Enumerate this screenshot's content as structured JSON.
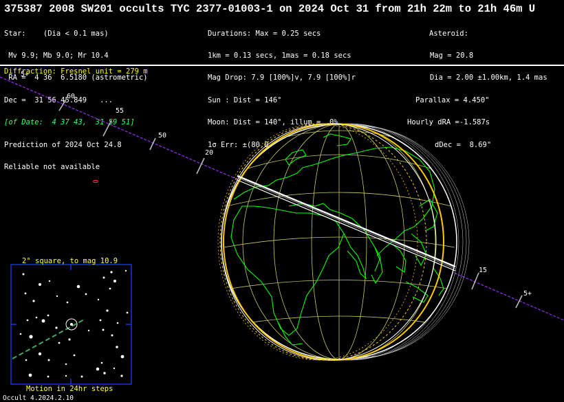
{
  "title": "375387 2008 SW201 occults TYC 2377-01003-1 on 2024 Oct 31 from 21h 22m to 21h 46m U",
  "star_block": [
    "Star:    (Dia < 0.1 mas)",
    " Mv 9.9; Mb 9.0; Mr 10.4",
    " RA =  4 36  6.5180 (astrometric)",
    "Dec =  31 56 45.849   ...",
    "[of Date:  4 37 43,  31 59 51]",
    "Prediction of 2024 Oct 24.8",
    "Reliable not available"
  ],
  "event_block": [
    "Durations: Max = 0.25 secs",
    "1km = 0.13 secs, 1mas = 0.18 secs",
    "Mag Drop: 7.9 [100%]v, 7.9 [100%]r",
    "Sun : Dist = 146°",
    "Moon: Dist = 140°, illum =  0%",
    "1σ Err: ±(80.0 x 43.0) mas in PA 76°"
  ],
  "asteroid_block": [
    "Asteroid:",
    "   Mag = 20.8",
    "   Dia = 2.00 ±1.00km, 1.4 mas",
    "Parallax = 4.450\"",
    "Hourly dRA =-1.587s",
    "dDec =  8.69\""
  ],
  "diffraction": "Diffraction: Fresnel unit = 279 m",
  "path_labels": [
    "5+",
    "60",
    "55",
    "50",
    "20",
    "15",
    "5+"
  ],
  "inset": {
    "top_label": "2° square, to mag 10.9",
    "bottom_label": "Motion in 24hr steps"
  },
  "footer": "Occult 4.2024.2.10",
  "colors": {
    "path": "#8a2be2",
    "land": "#00ff00",
    "grid": "#cccc66",
    "shadow": "#ffffff",
    "limit": "#ffcc00",
    "diffraction": "#ffff00",
    "inset_frame": "#1a3cff"
  }
}
